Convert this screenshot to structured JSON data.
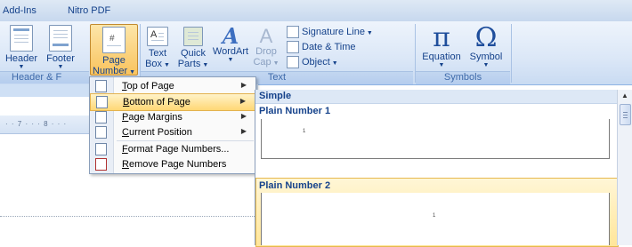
{
  "tabs": [
    "Add-Ins",
    "Nitro PDF"
  ],
  "ribbon": {
    "header_footer_group": {
      "label": "Header & F",
      "buttons": [
        {
          "label": "Header",
          "icon": "header-icon"
        },
        {
          "label": "Footer",
          "icon": "footer-icon"
        },
        {
          "label_top": "Page",
          "label_bottom": "Number",
          "icon": "page-number-icon"
        }
      ]
    },
    "text_group": {
      "label": "Text",
      "buttons": [
        {
          "label_top": "Text",
          "label_bottom": "Box",
          "icon": "text-box-icon"
        },
        {
          "label_top": "Quick",
          "label_bottom": "Parts",
          "icon": "quick-parts-icon"
        },
        {
          "label_top": "WordArt",
          "label_bottom": "",
          "icon": "wordart-icon"
        },
        {
          "label_top": "Drop",
          "label_bottom": "Cap",
          "icon": "drop-cap-icon"
        }
      ],
      "small_items": [
        {
          "label": "Signature Line",
          "icon": "signature-line-icon"
        },
        {
          "label": "Date & Time",
          "icon": "date-time-icon"
        },
        {
          "label": "Object",
          "icon": "object-icon"
        }
      ]
    },
    "symbols_group": {
      "label": "Symbols",
      "buttons": [
        {
          "label": "Equation",
          "glyph": "π",
          "icon": "equation-icon"
        },
        {
          "label": "Symbol",
          "glyph": "Ω",
          "icon": "symbol-icon"
        }
      ]
    }
  },
  "ruler": {
    "ticks": "· · 7 · · · 8 · · ·"
  },
  "menu": {
    "items": [
      {
        "hot": "T",
        "rest": "op of Page",
        "submenu": true,
        "icon": "top-of-page-icon"
      },
      {
        "hot": "B",
        "rest": "ottom of Page",
        "submenu": true,
        "icon": "bottom-of-page-icon"
      },
      {
        "hot": "P",
        "rest": "age Margins",
        "submenu": true,
        "icon": "page-margins-icon"
      },
      {
        "hot": "C",
        "rest": "urrent Position",
        "submenu": true,
        "icon": "current-position-icon"
      },
      {
        "hot": "F",
        "rest": "ormat Page Numbers...",
        "submenu": false,
        "icon": "format-page-numbers-icon"
      },
      {
        "hot": "R",
        "rest": "emove Page Numbers",
        "submenu": false,
        "icon": "remove-page-numbers-icon"
      }
    ]
  },
  "gallery": {
    "section": "Simple",
    "entries": [
      {
        "title": "Plain Number 1",
        "page_number": "1"
      },
      {
        "title": "Plain Number 2",
        "page_number": "1"
      }
    ]
  },
  "colors": {
    "ribbon_text": "#15428b",
    "highlight": "#ffd775",
    "selection": "#ffe69a"
  }
}
